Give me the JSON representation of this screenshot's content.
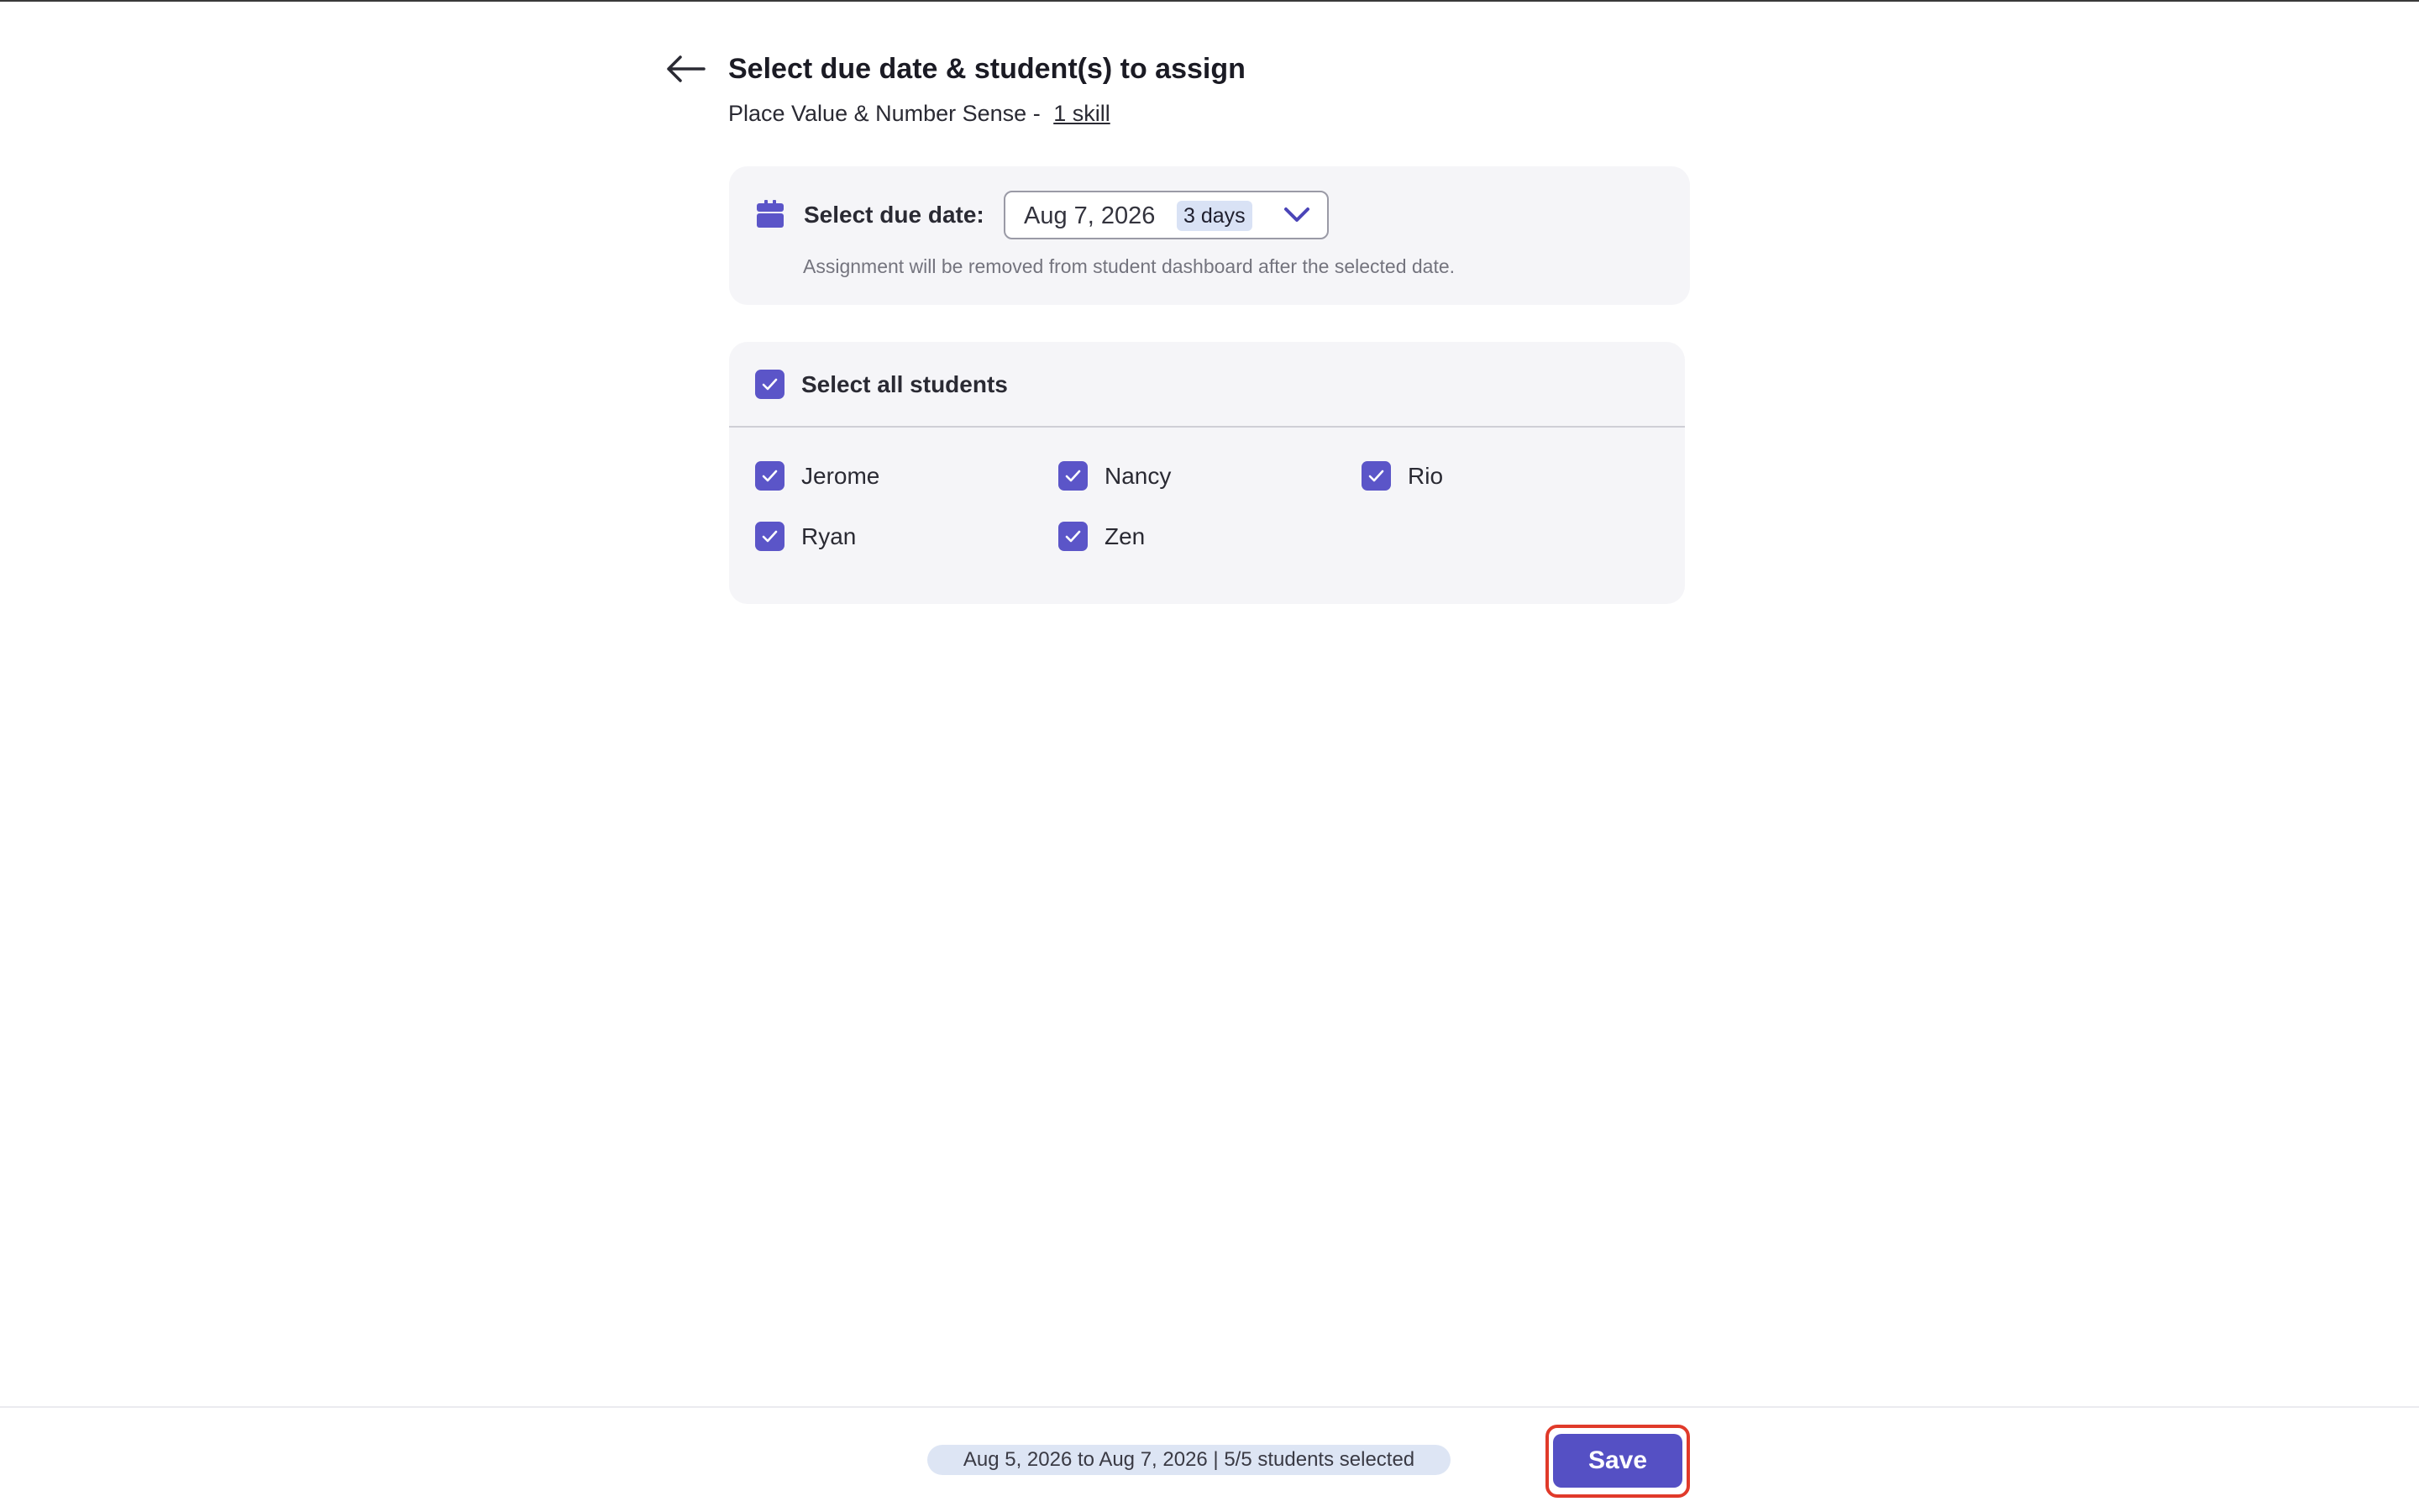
{
  "header": {
    "back_icon": "arrow-left-icon",
    "title": "Select due date & student(s) to assign",
    "topic": "Place Value & Number Sense -",
    "skills_link": "1 skill"
  },
  "due_date": {
    "icon": "calendar-icon",
    "label": "Select due date:",
    "value": "Aug 7, 2026",
    "days_badge": "3 days",
    "dropdown_icon": "chevron-down-icon",
    "hint": "Assignment will be removed from student dashboard after the selected date."
  },
  "students": {
    "select_all_label": "Select all students",
    "select_all_checked": true,
    "list": [
      {
        "name": "Jerome",
        "checked": true
      },
      {
        "name": "Nancy",
        "checked": true
      },
      {
        "name": "Rio",
        "checked": true
      },
      {
        "name": "Ryan",
        "checked": true
      },
      {
        "name": "Zen",
        "checked": true
      }
    ]
  },
  "footer": {
    "summary": "Aug 5, 2026 to Aug 7, 2026 | 5/5 students selected",
    "save_label": "Save"
  },
  "colors": {
    "accent": "#5b55c8",
    "card_bg": "#f5f5f8",
    "highlight_ring": "#e03a2a",
    "badge_bg": "#d9e2f5"
  }
}
